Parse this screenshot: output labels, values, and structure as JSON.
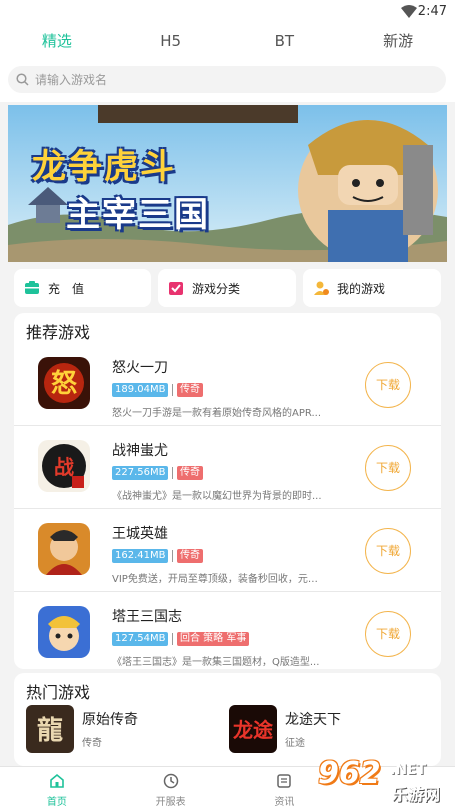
{
  "status": {
    "time": "2:47"
  },
  "tabs": [
    "精选",
    "H5",
    "BT",
    "新游"
  ],
  "search": {
    "placeholder": "请输入游戏名"
  },
  "banner": {
    "line1": "龙争虎斗",
    "line2": "主宰三国"
  },
  "quick": [
    {
      "label": "充　值",
      "icon": "wallet-icon"
    },
    {
      "label": "游戏分类",
      "icon": "category-icon"
    },
    {
      "label": "我的游戏",
      "icon": "user-game-icon"
    }
  ],
  "recommend": {
    "title": "推荐游戏",
    "download_label": "下载",
    "games": [
      {
        "name": "怒火一刀",
        "size": "189.04MB",
        "tag": "传奇",
        "desc": "怒火一刀手游是一款有着原始传奇风格的APR..."
      },
      {
        "name": "战神蚩尤",
        "size": "227.56MB",
        "tag": "传奇",
        "desc": "《战神蚩尤》是一款以魔幻世界为背景的即时..."
      },
      {
        "name": "王城英雄",
        "size": "162.41MB",
        "tag": "传奇",
        "desc": "VIP免费送，开局至尊顶级，装备秒回收，元宝..."
      },
      {
        "name": "塔王三国志",
        "size": "127.54MB",
        "tag": "回合 策略 军事",
        "desc": "《塔王三国志》是一款集三国题材，Q版造型..."
      }
    ]
  },
  "hot": {
    "title": "热门游戏",
    "games": [
      {
        "name": "原始传奇",
        "category": "传奇"
      },
      {
        "name": "龙途天下",
        "category": "征途"
      }
    ]
  },
  "bottom_nav": [
    "首页",
    "开服表",
    "资讯",
    ""
  ],
  "watermark": {
    "big": "962",
    "net": ".NET",
    "site": "乐游网"
  },
  "colors": {
    "accent": "#1ec29a",
    "download": "#f0a734",
    "size_badge": "#5ab7ea",
    "tag_badge": "#ee6e6e"
  }
}
